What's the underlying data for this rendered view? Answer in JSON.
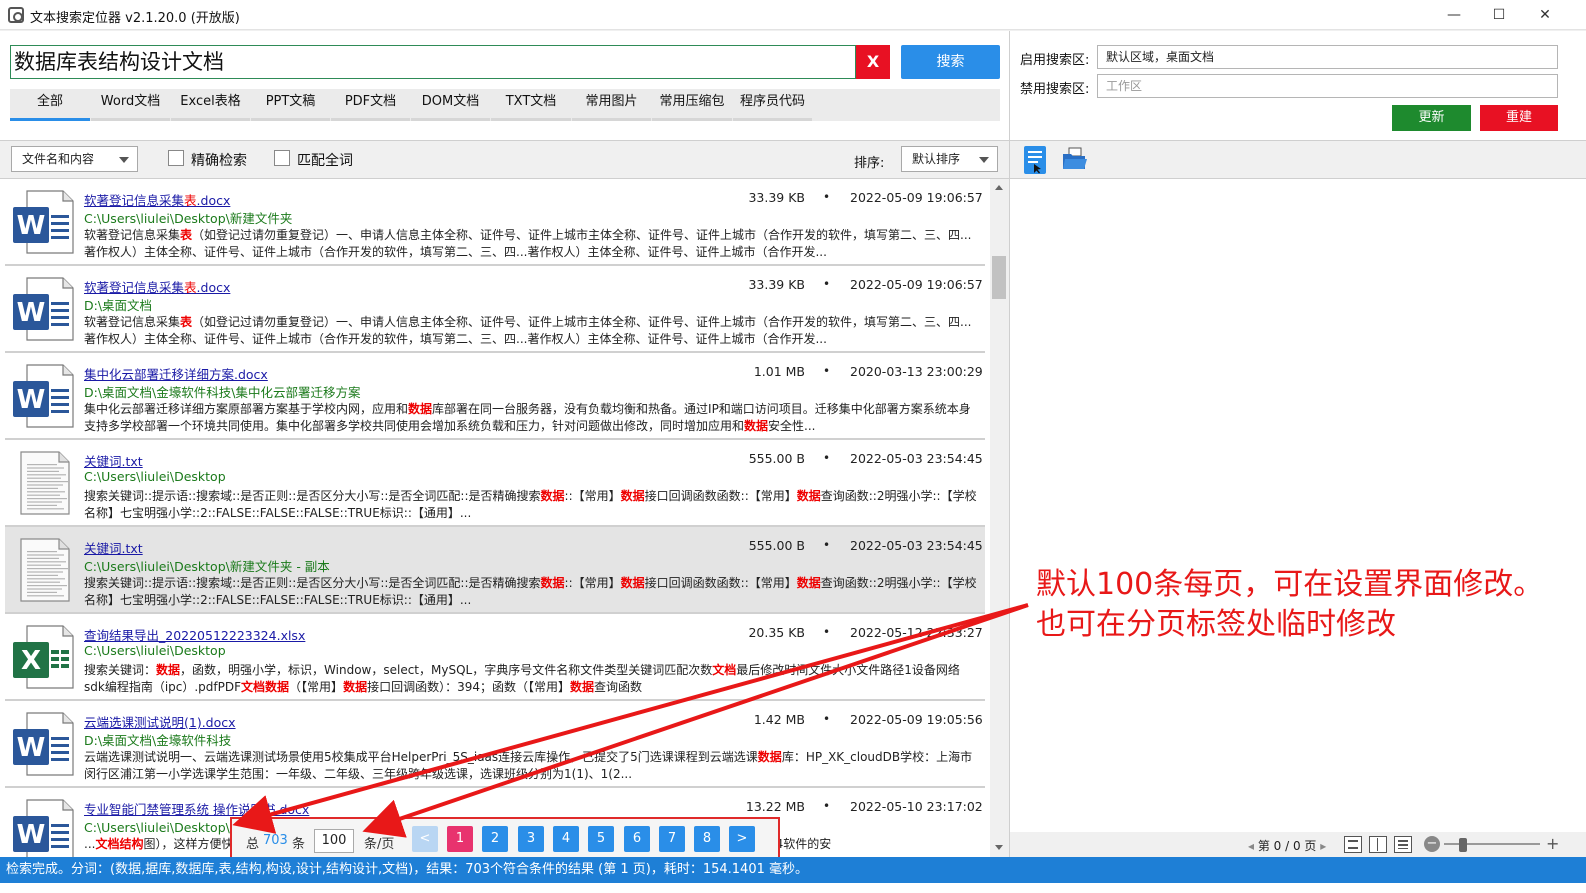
{
  "window": {
    "title": "文本搜索定位器 v2.1.20.0 (开放版)",
    "minimize": "—",
    "maximize": "☐",
    "close": "✕"
  },
  "search": {
    "query": "数据库表结构设计文档",
    "clear_label": "X",
    "search_label": "搜索"
  },
  "tabs": [
    {
      "label": "全部",
      "active": true
    },
    {
      "label": "Word文档"
    },
    {
      "label": "Excel表格"
    },
    {
      "label": "PPT文稿"
    },
    {
      "label": "PDF文档"
    },
    {
      "label": "DOM文档"
    },
    {
      "label": "TXT文档"
    },
    {
      "label": "常用图片"
    },
    {
      "label": "常用压缩包"
    },
    {
      "label": "程序员代码"
    }
  ],
  "areas": {
    "enabled_label": "启用搜索区:",
    "enabled_value": "默认区域，桌面文档",
    "disabled_label": "禁用搜索区:",
    "disabled_placeholder": "工作区",
    "update_label": "更新",
    "rebuild_label": "重建"
  },
  "filters": {
    "scope_value": "文件名和内容",
    "exact_label": "精确检索",
    "exact_checked": false,
    "whole_label": "匹配全词",
    "whole_checked": false,
    "sort_label": "排序:",
    "sort_value": "默认排序"
  },
  "results": [
    {
      "type": "word",
      "name_pre": "软著登记信息采集",
      "name_hl": "表",
      "name_post": ".docx",
      "size": "33.39 KB",
      "date": "2022-05-09 19:06:57",
      "path": "C:\\Users\\liulei\\Desktop\\新建文件夹",
      "snippet": [
        [
          "软著登记信息采集",
          false
        ],
        [
          "表",
          true
        ],
        [
          "（如登记过请勿重复登记）一、申请人信息主体全称、证件号、证件上城市主体全称、证件号、证件上城市（合作开发的软件，填写第二、三、四...著作权人）主体全称、证件号、证件上城市（合作开发的软件，填写第二、三、四...著作权人）主体全称、证件号、证件上城市（合作开发...",
          false
        ]
      ]
    },
    {
      "type": "word",
      "name_pre": "软著登记信息采集",
      "name_hl": "表",
      "name_post": ".docx",
      "size": "33.39 KB",
      "date": "2022-05-09 19:06:57",
      "path": "D:\\桌面文档",
      "snippet": [
        [
          "软著登记信息采集",
          false
        ],
        [
          "表",
          true
        ],
        [
          "（如登记过请勿重复登记）一、申请人信息主体全称、证件号、证件上城市主体全称、证件号、证件上城市（合作开发的软件，填写第二、三、四...著作权人）主体全称、证件号、证件上城市（合作开发的软件，填写第二、三、四...著作权人）主体全称、证件号、证件上城市（合作开发...",
          false
        ]
      ]
    },
    {
      "type": "word",
      "name_pre": "集中化云部署迁移详细方案.docx",
      "name_hl": "",
      "name_post": "",
      "size": "1.01 MB",
      "date": "2020-03-13 23:00:29",
      "path": "D:\\桌面文档\\金壕软件科技\\集中化云部署迁移方案",
      "snippet": [
        [
          "集中化云部署迁移详细方案原部署方案基于学校内网，应用和",
          false
        ],
        [
          "数据",
          true
        ],
        [
          "库部署在同一台服务器，没有负载均衡和热备。通过IP和端口访问项目。迁移集中化部署方案系统本身支持多学校部署一个环境共同使用。集中化部署多学校共同使用会增加系统负载和压力，针对问题做出修改，同时增加应用和",
          false
        ],
        [
          "数据",
          true
        ],
        [
          "安全性...",
          false
        ]
      ]
    },
    {
      "type": "txt",
      "name_pre": "关键词.txt",
      "name_hl": "",
      "name_post": "",
      "size": "555.00 B",
      "date": "2022-05-03 23:54:45",
      "path": "C:\\Users\\liulei\\Desktop",
      "snippet": [
        [
          "搜索关键词::提示语::搜索域::是否正则::是否区分大小写::是否全词匹配::是否精确搜索",
          false
        ],
        [
          "数据",
          true
        ],
        [
          "::【常用】",
          false
        ],
        [
          "数据",
          true
        ],
        [
          "接口回调函数函数::【常用】",
          false
        ],
        [
          "数据",
          true
        ],
        [
          "查询函数::2明强小学::【学校名称】七宝明强小学::2::FALSE::FALSE::FALSE::TRUE标识::【通用】...",
          false
        ]
      ]
    },
    {
      "type": "txt",
      "selected": true,
      "name_pre": "关键词.txt",
      "name_hl": "",
      "name_post": "",
      "size": "555.00 B",
      "date": "2022-05-03 23:54:45",
      "path": "C:\\Users\\liulei\\Desktop\\新建文件夹 - 副本",
      "snippet": [
        [
          "搜索关键词::提示语::搜索域::是否正则::是否区分大小写::是否全词匹配::是否精确搜索",
          false
        ],
        [
          "数据",
          true
        ],
        [
          "::【常用】",
          false
        ],
        [
          "数据",
          true
        ],
        [
          "接口回调函数函数::【常用】",
          false
        ],
        [
          "数据",
          true
        ],
        [
          "查询函数::2明强小学::【学校名称】七宝明强小学::2::FALSE::FALSE::FALSE::TRUE标识::【通用】...",
          false
        ]
      ]
    },
    {
      "type": "excel",
      "name_pre": "查询结果导出_20220512223324.xlsx",
      "name_hl": "",
      "name_post": "",
      "size": "20.35 KB",
      "date": "2022-05-12 22:33:27",
      "path": "C:\\Users\\liulei\\Desktop",
      "snippet": [
        [
          "搜索关键词：",
          false
        ],
        [
          "数据",
          true
        ],
        [
          "，函数，明强小学，标识，Window，select，MySQL，字典序号文件名称文件类型关键词匹配次数",
          false
        ],
        [
          "文档",
          true
        ],
        [
          "最后修改时间文件大小文件路径1设备网络sdk编程指南（ipc）.pdfPDF",
          false
        ],
        [
          "文档数据",
          true
        ],
        [
          "（【常用】",
          false
        ],
        [
          "数据",
          true
        ],
        [
          "接口回调函数）：394；函数（【常用】",
          false
        ],
        [
          "数据",
          true
        ],
        [
          "查询函数",
          false
        ]
      ]
    },
    {
      "type": "word",
      "name_pre": "云端选课测试说明(1).docx",
      "name_hl": "",
      "name_post": "",
      "size": "1.42 MB",
      "date": "2022-05-09 19:05:56",
      "path": "D:\\桌面文档\\金壕软件科技",
      "snippet": [
        [
          "云端选课测试说明一、云端选课测试场景使用5校集成平台HelperPri_5S_iaas连接云库操作，已提交了5门选课课程到云端选课",
          false
        ],
        [
          "数据",
          true
        ],
        [
          "库：HP_XK_cloudDB学校：上海市闵行区浦江第一小学选课学生范围：一年级、二年级、三年级跨年级选课，选课班级分别为1(1)、1(2...",
          false
        ]
      ]
    },
    {
      "type": "word",
      "name_pre": "专业智能门禁管理系统 操作说明书.docx",
      "name_hl": "",
      "name_post": "",
      "size": "13.22 MB",
      "date": "2022-05-10 23:17:02",
      "path": "C:\\Users\\liulei\\Desktop\\新建文件夹 - 副本",
      "snippet": [
        [
          "...",
          false
        ],
        [
          "文档结构",
          true
        ],
        [
          "图），这样方便快速查看操作说明书，部分内容可能与实际软件存在差异，请以软件实际为准。1.3软件支持的",
          false
        ],
        [
          "数据",
          true
        ],
        [
          "库71.4软件的安",
          false
        ]
      ]
    }
  ],
  "pager": {
    "total_prefix": "总",
    "total": "703",
    "total_suffix": "条",
    "page_size": "100",
    "page_size_suffix": "条/页",
    "prev": "<",
    "next": ">",
    "pages": [
      "1",
      "2",
      "3",
      "4",
      "5",
      "6",
      "7",
      "8"
    ],
    "current": "1"
  },
  "preview": {
    "page_info": "第 0 / 0 页",
    "zoom_minus": "−",
    "zoom_plus": "+",
    "zoom_level": 0.2
  },
  "status": "检索完成。分词：(数据,据库,数据库,表,结构,构设,设计,结构设计,文档)，结果：703个符合条件的结果 (第 1 页)，耗时：154.1401 毫秒。",
  "annotation": {
    "line1": "默认100条每页，可在设置界面修改。",
    "line2": "也可在分页标签处临时修改"
  },
  "colors": {
    "accent": "#2a8ee8",
    "danger": "#e81123",
    "success": "#1e8a2e",
    "page_active": "#e8336e",
    "highlight": "#e00000",
    "path": "#1b7a1b",
    "link": "#1a1aa6"
  }
}
